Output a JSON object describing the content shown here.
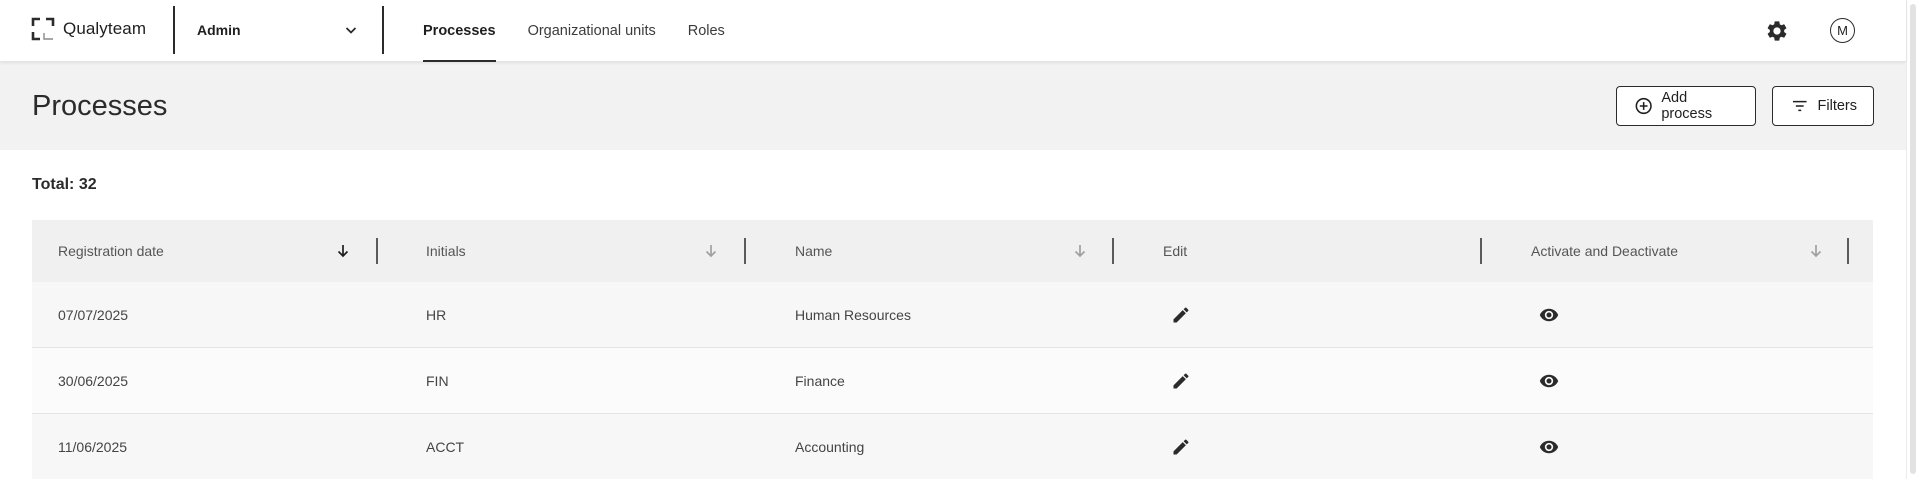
{
  "app": {
    "logo_text": "Qualyteam",
    "context_select": "Admin",
    "avatar_initial": "M"
  },
  "nav": {
    "tabs": [
      {
        "label": "Processes",
        "active": true
      },
      {
        "label": "Organizational units",
        "active": false
      },
      {
        "label": "Roles",
        "active": false
      }
    ]
  },
  "page": {
    "title": "Processes",
    "add_button": "Add process",
    "filters_button": "Filters"
  },
  "summary": {
    "total_label": "Total:",
    "total_count": "32"
  },
  "table": {
    "columns": [
      {
        "label": "Registration date",
        "sorted": true
      },
      {
        "label": "Initials",
        "sorted": false
      },
      {
        "label": "Name",
        "sorted": false
      },
      {
        "label": "Edit",
        "sorted": false
      },
      {
        "label": "Activate and Deactivate",
        "sorted": false
      }
    ],
    "rows": [
      {
        "date": "07/07/2025",
        "initials": "HR",
        "name": "Human Resources"
      },
      {
        "date": "30/06/2025",
        "initials": "FIN",
        "name": "Finance"
      },
      {
        "date": "11/06/2025",
        "initials": "ACCT",
        "name": "Accounting"
      }
    ]
  },
  "icons": {
    "logo": "logo-bracket-icon",
    "dropdown": "chevron-down-icon",
    "settings": "gear-icon",
    "add": "plus-circle-icon",
    "filters": "filter-lines-icon",
    "sort": "arrow-down-icon",
    "edit": "pencil-icon",
    "toggle": "eye-icon"
  },
  "colors": {
    "primary_text": "#2b2b2b",
    "header_background": "#f2f2f2",
    "table_header_background": "#f0f0f0"
  }
}
